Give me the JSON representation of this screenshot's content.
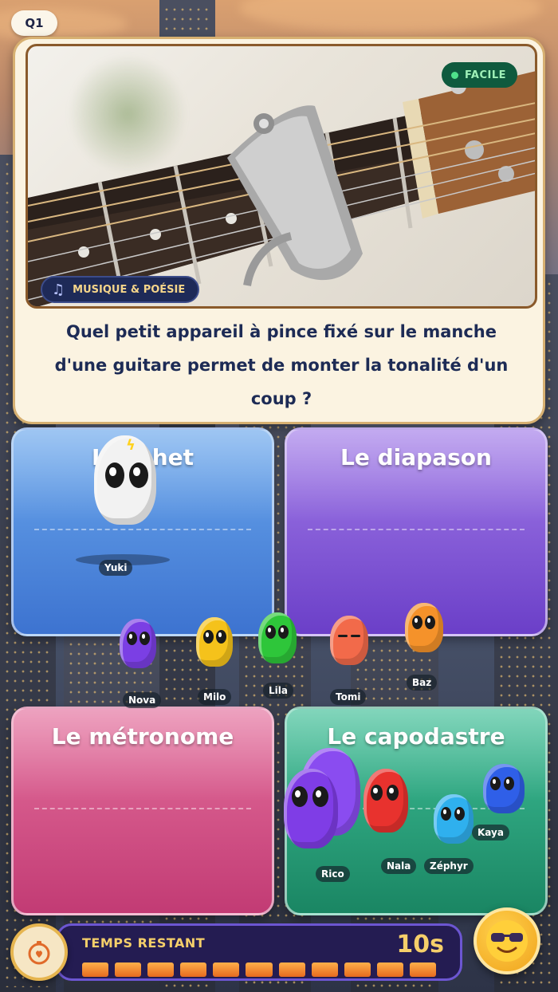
{
  "round": {
    "label": "Q1"
  },
  "question": {
    "difficulty": "FACILE",
    "category": "MUSIQUE & POÉSIE",
    "category_icon": "music-note-icon",
    "text": "Quel petit appareil à pince fixé sur le manche d'une guitare permet de monter la tonalité d'un coup ?"
  },
  "answers": [
    {
      "label": "L'archet",
      "color": "#4f8ce0"
    },
    {
      "label": "Le diapason",
      "color": "#8a5ad8"
    },
    {
      "label": "Le métronome",
      "color": "#d25088"
    },
    {
      "label": "Le capodastre",
      "color": "#2aa27b"
    }
  ],
  "players": [
    {
      "name": "Yuki",
      "color": "#f2f2f2"
    },
    {
      "name": "Nova",
      "color": "#7b3fe4"
    },
    {
      "name": "Milo",
      "color": "#f5c21b"
    },
    {
      "name": "Lila",
      "color": "#2ec63a"
    },
    {
      "name": "Tomi",
      "color": "#f26a4a"
    },
    {
      "name": "Baz",
      "color": "#f5922a"
    },
    {
      "name": "Rico",
      "color": "#7f3de6"
    },
    {
      "name": "Nala",
      "color": "#e8322e"
    },
    {
      "name": "Zéphyr",
      "color": "#2fb0ee"
    },
    {
      "name": "Kaya",
      "color": "#2f5fe8"
    }
  ],
  "timer": {
    "label": "TEMPS RESTANT",
    "value": "10s",
    "remaining_fraction": 1.0,
    "icon": "stopwatch-icon"
  },
  "reaction_button": {
    "icon": "sunglasses-emoji-icon"
  }
}
